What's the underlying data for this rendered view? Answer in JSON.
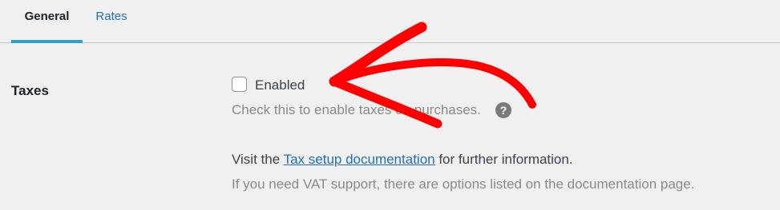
{
  "tabs": [
    {
      "label": "General",
      "active": true
    },
    {
      "label": "Rates",
      "active": false
    }
  ],
  "taxes": {
    "label": "Taxes",
    "checkbox_label": "Enabled",
    "checked": false,
    "help": "Check this to enable taxes on purchases.",
    "help_icon": "?"
  },
  "info": {
    "visit_prefix": "Visit the ",
    "link_text": "Tax setup documentation",
    "visit_suffix": " for further information.",
    "vat_text": "If you need VAT support, there are options listed on the documentation page."
  },
  "annotation": {
    "arrow_color": "#ff0000",
    "icon": "red-arrow-icon"
  },
  "colors": {
    "accent": "#2ea2cc",
    "link": "#2271b1",
    "background": "#f0f0f1"
  }
}
